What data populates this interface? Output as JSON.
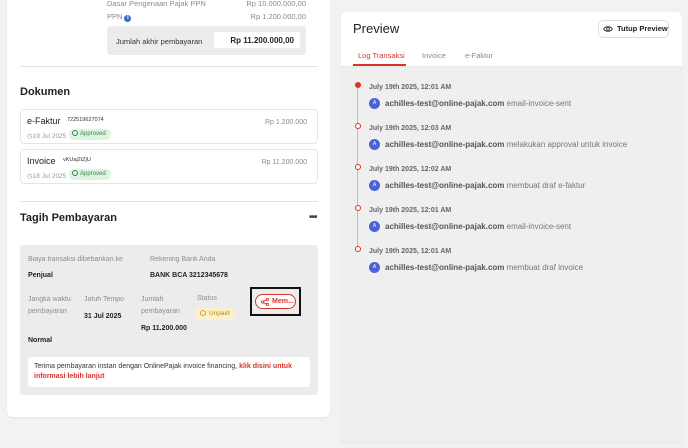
{
  "summary": {
    "dpp_label": "Dasar Pengenaan Pajak PPN",
    "dpp_value": "Rp 10.000.000,00",
    "ppn_label": "PPN",
    "ppn_value": "Rp 1.200.000,00",
    "total_label": "Jumlah akhir pembayaran",
    "total_value": "Rp 11.200.000,00"
  },
  "dokumen": {
    "title": "Dokumen",
    "items": [
      {
        "name": "e-Faktur",
        "number": "722519627074",
        "date": "19 Jul 2025",
        "status": "Approved",
        "amount": "Rp 1.200.000"
      },
      {
        "name": "Invoice",
        "number": "vKUaj2tZjU",
        "date": "18 Jul 2025",
        "status": "Approved",
        "amount": "Rp 11.200.000"
      }
    ]
  },
  "tagih": {
    "title": "Tagih Pembayaran",
    "menu_icon": "more-icon",
    "biaya_label": "Biaya transaksi dibebankan ke",
    "biaya_value": "Penjual",
    "rekening_label": "Rekening Bank Anda",
    "rekening_value": "BANK BCA 3212345678",
    "jangka_label": "Jangka waktu pembayaran",
    "jangka_value": "Normal",
    "jatuh_label": "Jatuh Tempo",
    "jatuh_value": "31 Jul 2025",
    "jumlah_label": "Jumlah pembayaran",
    "jumlah_value": "Rp 11.200.000",
    "status_label": "Status",
    "status_value": "Unpaid",
    "share_label": "Mem...",
    "note_text": "Terima pembayaran instan dengan OnlinePajak invoice financing, ",
    "note_link": "klik disini untuk informasi lebih lanjut"
  },
  "preview": {
    "title": "Preview",
    "close_label": "Tutup Preview",
    "tabs": [
      {
        "label": "Log Transaksi",
        "active": true
      },
      {
        "label": "Invoice",
        "active": false
      },
      {
        "label": "e-Faktur",
        "active": false
      }
    ],
    "logs": [
      {
        "date": "July 19th 2025, 12:01 AM",
        "avatar": "A",
        "user": "achilles-test@online-pajak.com",
        "action": "email-invoice-sent"
      },
      {
        "date": "July 19th 2025, 12:03 AM",
        "avatar": "A",
        "user": "achilles-test@online-pajak.com",
        "action": "melakukan approval untuk invoice"
      },
      {
        "date": "July 19th 2025, 12:02 AM",
        "avatar": "A",
        "user": "achilles-test@online-pajak.com",
        "action": "membuat draf e-faktur"
      },
      {
        "date": "July 19th 2025, 12:01 AM",
        "avatar": "A",
        "user": "achilles-test@online-pajak.com",
        "action": "email-invoice-sent"
      },
      {
        "date": "July 19th 2025, 12:01 AM",
        "avatar": "A",
        "user": "achilles-test@online-pajak.com",
        "action": "membuat draf invoice"
      }
    ]
  },
  "colors": {
    "accent": "#d9342b",
    "approved": "#2e8b47",
    "unpaid": "#b98a16",
    "avatar": "#4a63d6"
  }
}
